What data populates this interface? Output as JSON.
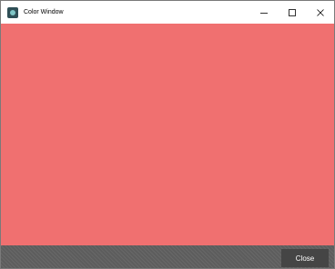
{
  "window": {
    "title": "Color Window",
    "app_icon": "app-icon",
    "controls": {
      "minimize_icon": "minimize-icon",
      "maximize_icon": "maximize-icon",
      "close_icon": "close-icon"
    }
  },
  "content": {
    "fill_color": "#f07070"
  },
  "footer": {
    "close_label": "Close",
    "close_button_color": "#454545"
  }
}
